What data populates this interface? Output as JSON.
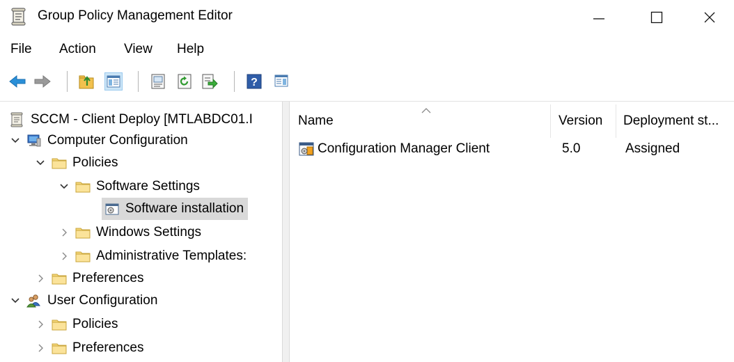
{
  "window": {
    "title": "Group Policy Management Editor"
  },
  "menu": {
    "file": "File",
    "action": "Action",
    "view": "View",
    "help": "Help"
  },
  "toolbar": {
    "icons": [
      "back-arrow-icon",
      "forward-arrow-icon",
      "up-folder-icon",
      "show-hide-tree-icon",
      "properties-icon",
      "refresh-icon",
      "export-list-icon",
      "help-icon",
      "show-action-pane-icon"
    ]
  },
  "tree": {
    "root": "SCCM - Client Deploy [MTLABDC01.I",
    "computer_configuration": "Computer Configuration",
    "policies": "Policies",
    "software_settings": "Software Settings",
    "software_installation": "Software installation",
    "windows_settings": "Windows Settings",
    "administrative_templates": "Administrative Templates:",
    "preferences": "Preferences",
    "user_configuration": "User Configuration",
    "user_policies": "Policies",
    "user_preferences": "Preferences"
  },
  "list": {
    "columns": {
      "name": "Name",
      "version": "Version",
      "deployment_state": "Deployment st..."
    },
    "rows": [
      {
        "name": "Configuration Manager Client",
        "version": "5.0",
        "deployment_state": "Assigned"
      }
    ]
  }
}
